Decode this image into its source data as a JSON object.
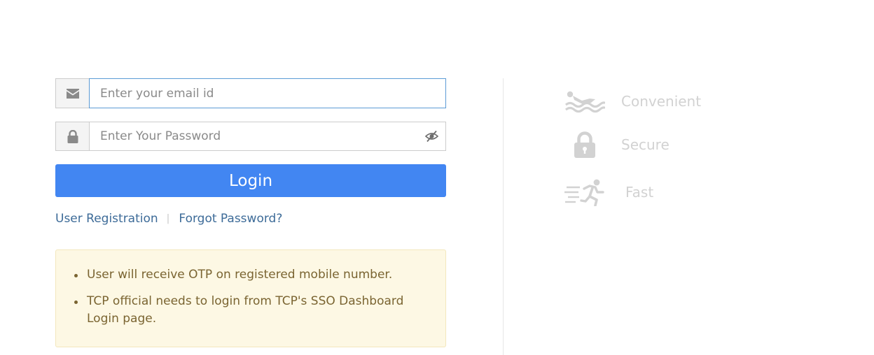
{
  "form": {
    "email": {
      "placeholder": "Enter your email id",
      "value": "",
      "icon": "envelope-icon"
    },
    "password": {
      "placeholder": "Enter Your Password",
      "value": "",
      "icon": "lock-icon",
      "toggle_icon": "eye-slash-icon"
    },
    "login_label": "Login",
    "links": {
      "register": "User Registration",
      "separator": "|",
      "forgot": "Forgot Password?"
    }
  },
  "notice": {
    "items": [
      "User will receive OTP on registered mobile number.",
      "TCP official needs to login from TCP's SSO Dashboard Login page."
    ]
  },
  "features": [
    {
      "label": "Convenient",
      "icon": "swimmer-icon"
    },
    {
      "label": "Secure",
      "icon": "padlock-icon"
    },
    {
      "label": "Fast",
      "icon": "running-person-icon"
    }
  ],
  "colors": {
    "primary_button": "#4286f2",
    "link": "#3d6b98",
    "notice_bg": "#fdf8e4",
    "notice_text": "#7a6431",
    "feature_muted": "#d2d2d2"
  }
}
